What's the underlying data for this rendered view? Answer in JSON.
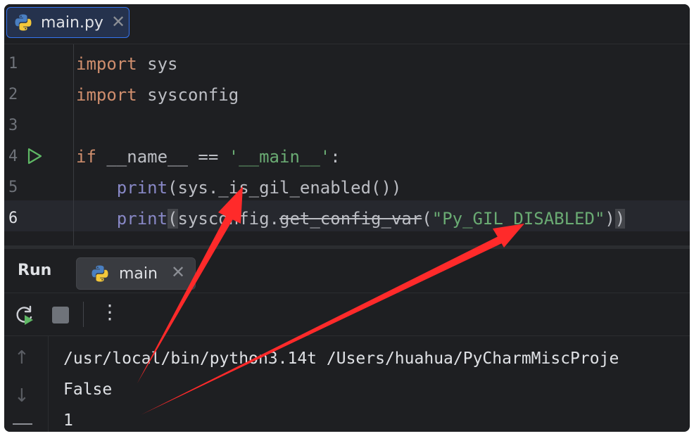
{
  "editor_tab": {
    "label": "main.py",
    "close": "✕",
    "icon": "python-icon"
  },
  "code": {
    "line_numbers": [
      "1",
      "2",
      "3",
      "4",
      "5",
      "6"
    ],
    "lines": [
      {
        "kw": "import",
        "rest": " sys"
      },
      {
        "kw": "import",
        "rest": " sysconfig"
      },
      {},
      {
        "kw": "if",
        "rest": " __name__ == ",
        "str": "'__main__'",
        "tail": ":"
      },
      {
        "indent": "    ",
        "builtin": "print",
        "rest": "(sys._is_gil_enabled())"
      },
      {
        "indent": "    ",
        "builtin": "print",
        "open": "(",
        "module": "sysconfig.",
        "deprecated": "get_config_var",
        "paren2": "(",
        "str": "\"Py_GIL_DISABLED\"",
        "close_inner": ")",
        "close": ")"
      }
    ]
  },
  "run_panel": {
    "title": "Run",
    "tab": {
      "label": "main",
      "close": "✕",
      "icon": "python-icon"
    },
    "toolbar": {
      "rerun_icon": "rerun-icon",
      "stop_icon": "stop-icon",
      "more": "⋮"
    },
    "gutter": {
      "up": "↑",
      "down": "↓"
    }
  },
  "console": {
    "lines": [
      "/usr/local/bin/python3.14t /Users/huahua/PyCharmMiscProje",
      "False",
      "1"
    ]
  },
  "colors": {
    "background": "#1e1f22",
    "keyword": "#cf8e6d",
    "builtin": "#8888c6",
    "string": "#6aab73",
    "text": "#bcbec4",
    "annotation_arrow": "#ff2a2a"
  }
}
